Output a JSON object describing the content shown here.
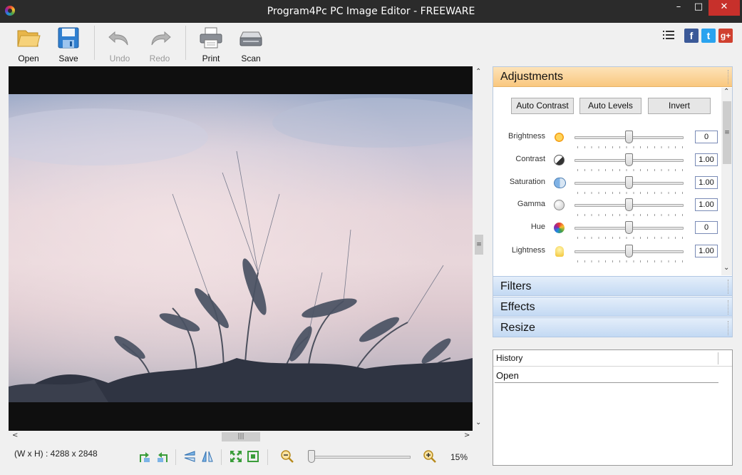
{
  "window": {
    "title": "Program4Pc PC Image Editor - FREEWARE"
  },
  "toolbar": {
    "open_label": "Open",
    "save_label": "Save",
    "undo_label": "Undo",
    "redo_label": "Redo",
    "print_label": "Print",
    "scan_label": "Scan",
    "facebook": "f",
    "twitter": "t",
    "googleplus": "g+"
  },
  "adjustments": {
    "title": "Adjustments",
    "buttons": {
      "auto_contrast": "Auto Contrast",
      "auto_levels": "Auto Levels",
      "invert": "Invert"
    },
    "rows": [
      {
        "label": "Brightness",
        "value": "0",
        "icon": "sun-icon"
      },
      {
        "label": "Contrast",
        "value": "1.00",
        "icon": "contrast-icon"
      },
      {
        "label": "Saturation",
        "value": "1.00",
        "icon": "saturation-icon"
      },
      {
        "label": "Gamma",
        "value": "1.00",
        "icon": "gamma-icon"
      },
      {
        "label": "Hue",
        "value": "0",
        "icon": "color-wheel-icon"
      },
      {
        "label": "Lightness",
        "value": "1.00",
        "icon": "bulb-icon"
      }
    ]
  },
  "sections": {
    "filters": "Filters",
    "effects": "Effects",
    "resize": "Resize"
  },
  "history": {
    "header": "History",
    "items": [
      "Open"
    ]
  },
  "status": {
    "dimensions": "(W x H) : 4288 x 2848",
    "zoom": "15%"
  },
  "colors": {
    "accent_orange": "#f9c87f",
    "panel_blue": "#c3d9f3",
    "close_red": "#c7302b"
  }
}
